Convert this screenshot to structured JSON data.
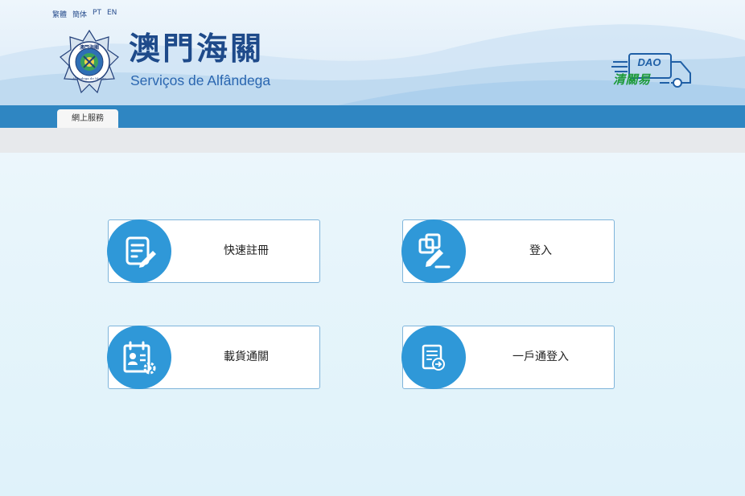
{
  "language_bar": [
    "繁體",
    "簡体",
    "PT",
    "EN"
  ],
  "brand": {
    "name_cn": "澳門海關",
    "name_pt": "Serviços de Alfândega",
    "emblem_text": "澳門海關",
    "emblem_ring_text": "Alfândega de Macau"
  },
  "dao_logo": {
    "label": "DAO",
    "text_cn": "清關易"
  },
  "nav": {
    "tab_label": "網上服務"
  },
  "cards": [
    {
      "label": "快速註冊",
      "icon": "edit-document-icon"
    },
    {
      "label": "登入",
      "icon": "login-pen-icon"
    },
    {
      "label": "載貨通關",
      "icon": "cargo-clearance-icon"
    },
    {
      "label": "一戶通登入",
      "icon": "account-login-icon"
    }
  ],
  "colors": {
    "nav_blue": "#2f86c2",
    "icon_blue": "#2f98d8",
    "brand_blue": "#1e4a8a",
    "dao_green": "#1d9a3a"
  }
}
